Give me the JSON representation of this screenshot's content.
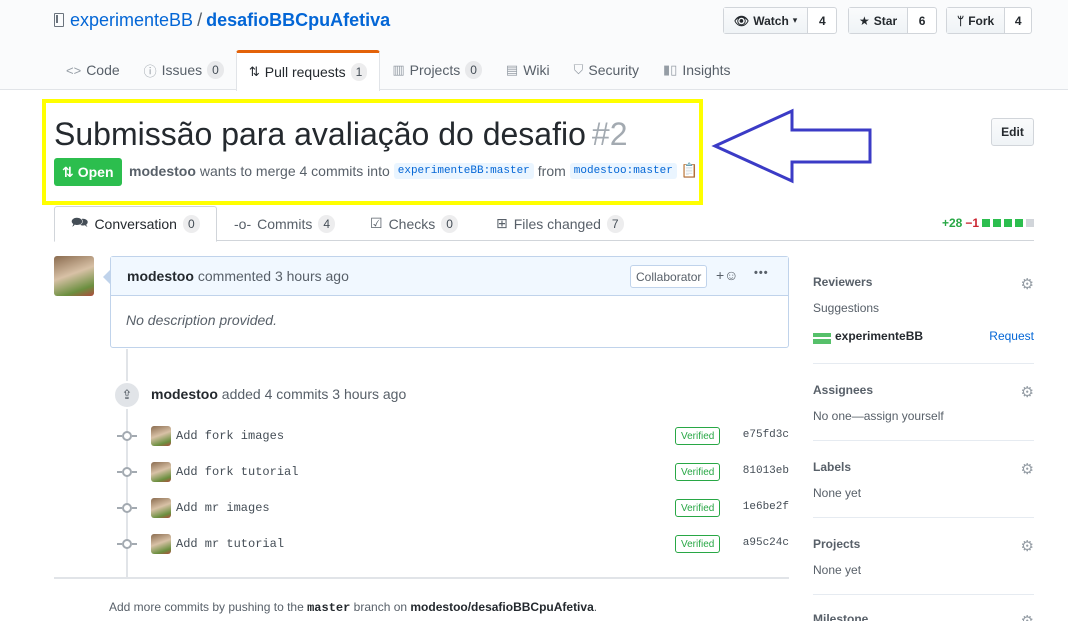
{
  "repo": {
    "owner": "experimenteBB",
    "separator": "/",
    "name": "desafioBBCpuAfetiva"
  },
  "actions": {
    "watch": {
      "label": "Watch",
      "count": "4"
    },
    "star": {
      "label": "Star",
      "count": "6"
    },
    "fork": {
      "label": "Fork",
      "count": "4"
    }
  },
  "nav_tabs": [
    {
      "label": "Code",
      "count": ""
    },
    {
      "label": "Issues",
      "count": "0"
    },
    {
      "label": "Pull requests",
      "count": "1"
    },
    {
      "label": "Projects",
      "count": "0"
    },
    {
      "label": "Wiki",
      "count": ""
    },
    {
      "label": "Security",
      "count": ""
    },
    {
      "label": "Insights",
      "count": ""
    }
  ],
  "pr": {
    "title": "Submissão para avaliação do desafio",
    "number": "#2",
    "state": "Open",
    "author": "modestoo",
    "merge_text": "wants to merge 4 commits into",
    "base_branch": "experimenteBB:master",
    "from_text": "from",
    "head_branch": "modestoo:master",
    "edit_label": "Edit"
  },
  "pr_tabs": [
    {
      "label": "Conversation",
      "count": "0"
    },
    {
      "label": "Commits",
      "count": "4"
    },
    {
      "label": "Checks",
      "count": "0"
    },
    {
      "label": "Files changed",
      "count": "7"
    }
  ],
  "diffstat": {
    "additions": "+28",
    "deletions": "−1"
  },
  "comment": {
    "author": "modestoo",
    "action": "commented",
    "time": "3 hours ago",
    "badge": "Collaborator",
    "reaction_icon": "+☺",
    "more_icon": "•••",
    "body": "No description provided."
  },
  "push_event": {
    "author": "modestoo",
    "text": "added 4 commits",
    "time": "3 hours ago"
  },
  "commits": [
    {
      "message": "Add fork images",
      "verified": "Verified",
      "sha": "e75fd3c"
    },
    {
      "message": "Add fork tutorial",
      "verified": "Verified",
      "sha": "81013eb"
    },
    {
      "message": "Add mr images",
      "verified": "Verified",
      "sha": "1e6be2f"
    },
    {
      "message": "Add mr tutorial",
      "verified": "Verified",
      "sha": "a95c24c"
    }
  ],
  "tip": {
    "pre": "Add more commits by pushing to the",
    "branch": "master",
    "mid": "branch on",
    "repo": "modestoo/desafioBBCpuAfetiva",
    "end": "."
  },
  "sidebar": {
    "reviewers": {
      "title": "Reviewers",
      "suggestions": "Suggestions",
      "suggested_user": "experimenteBB",
      "request": "Request"
    },
    "assignees": {
      "title": "Assignees",
      "value": "No one—assign yourself"
    },
    "labels": {
      "title": "Labels",
      "value": "None yet"
    },
    "projects": {
      "title": "Projects",
      "value": "None yet"
    },
    "milestone": {
      "title": "Milestone"
    }
  },
  "colors": {
    "open_green": "#2cbe4e",
    "link_blue": "#0366d6",
    "highlight_yellow": "#ffff00",
    "arrow_blue": "#3b3bc6",
    "tab_accent": "#e36209"
  }
}
